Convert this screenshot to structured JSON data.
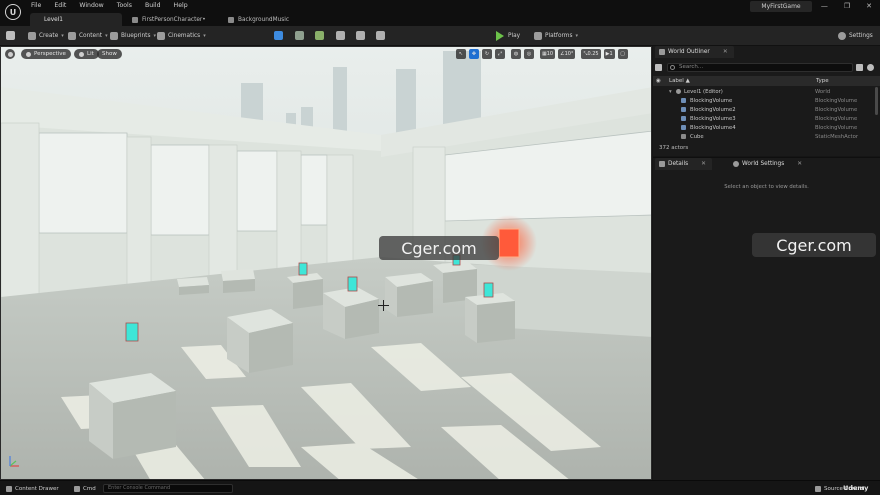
{
  "app": {
    "logo_glyph": "U",
    "menu": [
      "File",
      "Edit",
      "Window",
      "Tools",
      "Build",
      "Help"
    ],
    "project_name": "MyFirstGame",
    "window_controls": [
      "—",
      "❐",
      "✕"
    ]
  },
  "tabs": [
    {
      "label": "Level1",
      "active": true
    },
    {
      "label": "FirstPersonCharacter•",
      "active": false
    },
    {
      "label": "BackgroundMusic",
      "active": false
    }
  ],
  "toolbar": {
    "create": "Create",
    "content": "Content",
    "blueprints": "Blueprints",
    "cinematics": "Cinematics",
    "play": "Play",
    "platforms": "Platforms",
    "settings": "Settings",
    "caret": "▾"
  },
  "viewport": {
    "perspective": "Perspective",
    "lit": "Lit",
    "show": "Show",
    "grid_snap": "10",
    "rotate_snap": "10°",
    "scale_snap": "0.25",
    "camera_speed": "1",
    "watermark": "Cger.com"
  },
  "outliner": {
    "title": "World Outliner",
    "search_placeholder": "Search...",
    "col_label": "Label ▲",
    "col_type": "Type",
    "rows": [
      {
        "label": "Level1 (Editor)",
        "type": "World",
        "indent": 1
      },
      {
        "label": "BlockingVolume",
        "type": "BlockingVolume",
        "indent": 2
      },
      {
        "label": "BlockingVolume2",
        "type": "BlockingVolume",
        "indent": 2
      },
      {
        "label": "BlockingVolume3",
        "type": "BlockingVolume",
        "indent": 2
      },
      {
        "label": "BlockingVolume4",
        "type": "BlockingVolume",
        "indent": 2
      },
      {
        "label": "Cube",
        "type": "StaticMeshActor",
        "indent": 2
      }
    ],
    "actor_count": "372 actors"
  },
  "details": {
    "tab_details": "Details",
    "tab_world_settings": "World Settings",
    "empty_text": "Select an object to view details."
  },
  "statusbar": {
    "content_drawer": "Content Drawer",
    "cmd": "Cmd",
    "console_placeholder": "Enter Console Command",
    "source_control": "Source Control",
    "udemy": "Udemy"
  },
  "colors": {
    "accent_blue": "#1f6fd1",
    "play_green": "#6cc24a",
    "glow_red": "#ff4b2b",
    "crystal_cyan": "#3ee6d8"
  }
}
